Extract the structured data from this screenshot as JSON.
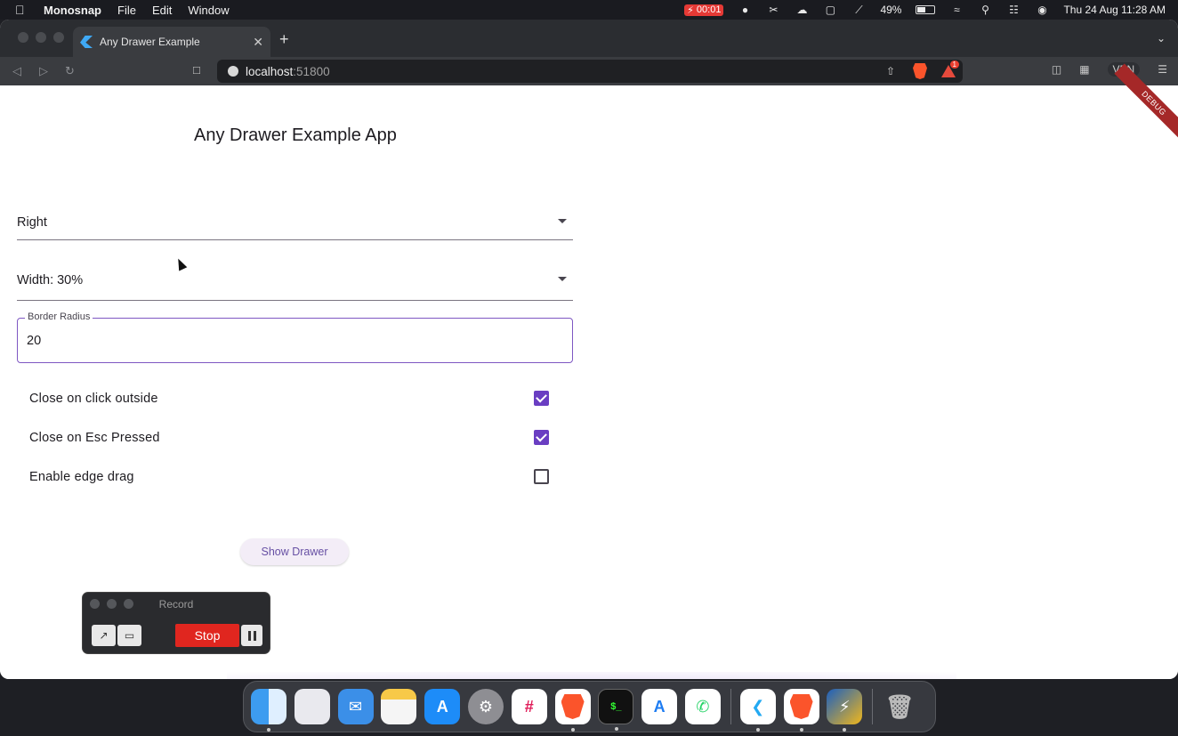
{
  "menubar": {
    "app_name": "Monosnap",
    "menus": [
      "File",
      "Edit",
      "Window"
    ],
    "recording_time": "00:01",
    "battery_percent": "49%",
    "datetime": "Thu 24 Aug  11:28 AM"
  },
  "browser": {
    "tab_title": "Any Drawer Example",
    "new_tab_symbol": "+",
    "url_host": "localhost",
    "url_port": ":51800",
    "notification_count": "1",
    "vpn_label": "VPN"
  },
  "page": {
    "debug_banner": "DEBUG",
    "title": "Any Drawer Example App",
    "side_dropdown": {
      "value": "Right"
    },
    "width_dropdown": {
      "value": "Width: 30%"
    },
    "border_radius_field": {
      "label": "Border Radius",
      "value": "20"
    },
    "options": [
      {
        "label": "Close on click outside",
        "checked": true
      },
      {
        "label": "Close on Esc Pressed",
        "checked": true
      },
      {
        "label": "Enable edge drag",
        "checked": false
      }
    ],
    "show_drawer_label": "Show Drawer"
  },
  "record_widget": {
    "title": "Record",
    "stop_label": "Stop"
  },
  "dock": {
    "apps": [
      "Finder",
      "Launchpad",
      "Mail",
      "Notes",
      "App Store",
      "System Settings",
      "Slack",
      "Brave",
      "Terminal",
      "Xcode Instruments",
      "WhatsApp",
      "Visual Studio Code",
      "Brave",
      "Reeder",
      "Trash"
    ]
  },
  "colors": {
    "accent": "#6a3ec2",
    "button_bg": "#f3edf7",
    "button_text": "#6750a4",
    "stop_red": "#e0261f",
    "debug_red": "#a52828"
  }
}
